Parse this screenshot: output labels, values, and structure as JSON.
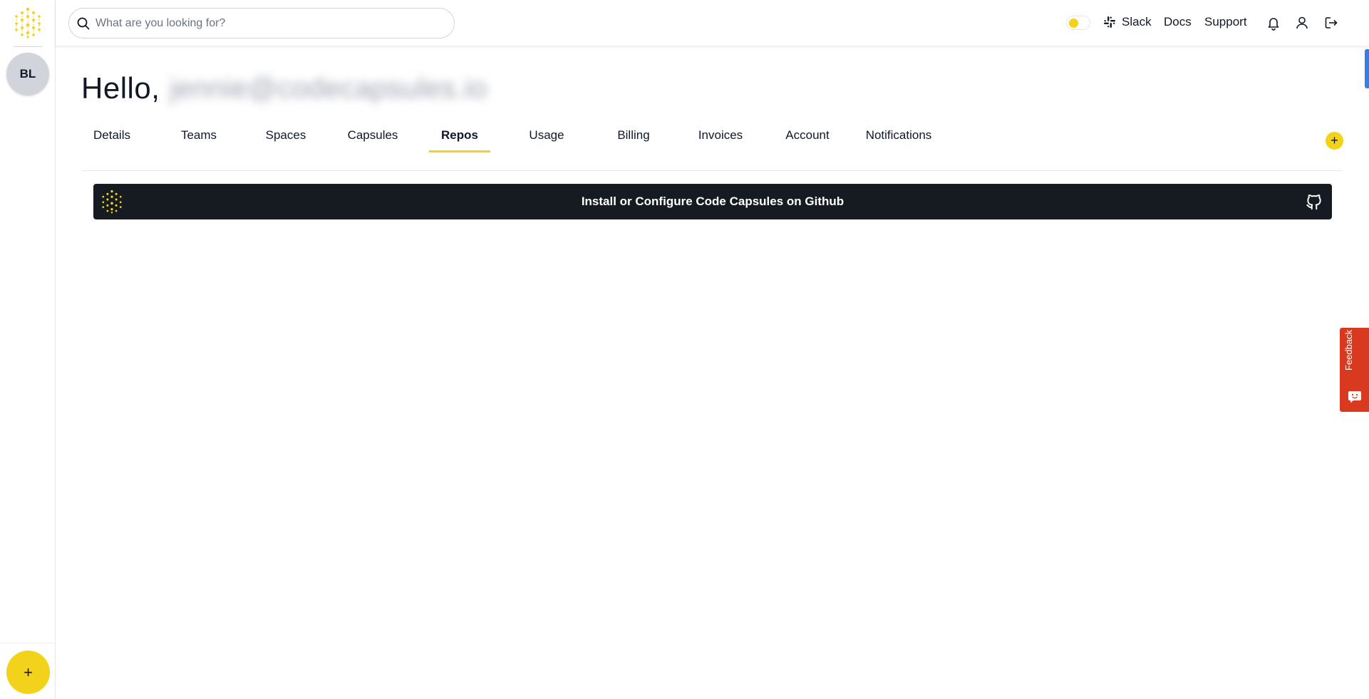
{
  "sidebar": {
    "avatar_initials": "BL",
    "fab_label": "+"
  },
  "topbar": {
    "search_placeholder": "What are you looking for?",
    "slack_label": "Slack",
    "docs_label": "Docs",
    "support_label": "Support"
  },
  "greeting": {
    "prefix": "Hello,",
    "email": "jennie@codecapsules.io"
  },
  "tabs": [
    {
      "label": "Details"
    },
    {
      "label": "Teams"
    },
    {
      "label": "Spaces"
    },
    {
      "label": "Capsules"
    },
    {
      "label": "Repos"
    },
    {
      "label": "Usage"
    },
    {
      "label": "Billing"
    },
    {
      "label": "Invoices"
    },
    {
      "label": "Account"
    },
    {
      "label": "Notifications"
    }
  ],
  "active_tab": "Repos",
  "add_button_label": "+",
  "banner": {
    "text": "Install or Configure Code Capsules on Github"
  },
  "feedback": {
    "label": "Feedback"
  },
  "colors": {
    "accent": "#f2d21b",
    "banner_bg": "#161b22",
    "feedback_bg": "#d9391f",
    "side_tab": "#2f80ed"
  },
  "icons": [
    "logo-icon",
    "search-icon",
    "theme-toggle",
    "slack-icon",
    "bell-icon",
    "user-icon",
    "logout-icon",
    "github-icon",
    "feedback-icon"
  ]
}
